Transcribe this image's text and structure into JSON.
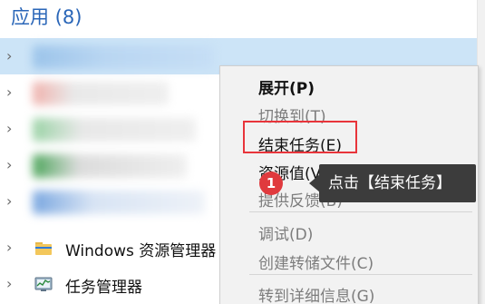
{
  "group": {
    "title": "应用 (8)"
  },
  "rows": [
    {
      "label": ""
    },
    {
      "label": ""
    },
    {
      "label": ""
    },
    {
      "label": ""
    },
    {
      "label": ""
    },
    {
      "label": "Windows 资源管理器"
    },
    {
      "label": "任务管理器"
    }
  ],
  "context_menu": {
    "items": [
      {
        "label": "展开(P)",
        "state": "default-bold"
      },
      {
        "label": "切换到(T)",
        "state": "disabled"
      },
      {
        "label": "结束任务(E)",
        "state": "enabled"
      },
      {
        "label": "资源值(V)",
        "state": "enabled",
        "submenu": true
      },
      {
        "label": "提供反馈(B)",
        "state": "disabled"
      },
      {
        "label": "调试(D)",
        "state": "disabled"
      },
      {
        "label": "创建转储文件(C)",
        "state": "disabled"
      },
      {
        "label": "转到详细信息(G)",
        "state": "disabled"
      }
    ],
    "submenu_arrow": "›"
  },
  "annotation": {
    "step_number": "1",
    "tooltip": "点击【结束任务】",
    "highlight_color": "#e8353b"
  },
  "icons": {
    "chevron": "chevron-right-icon",
    "explorer": "folder-icon",
    "taskmgr": "task-manager-icon"
  },
  "colors": {
    "group_header": "#2a66b8",
    "selected_row": "#cce4f7",
    "menu_background": "#f2f2f2",
    "tooltip_background": "#3c3c3c",
    "badge": "#e03a3e"
  }
}
